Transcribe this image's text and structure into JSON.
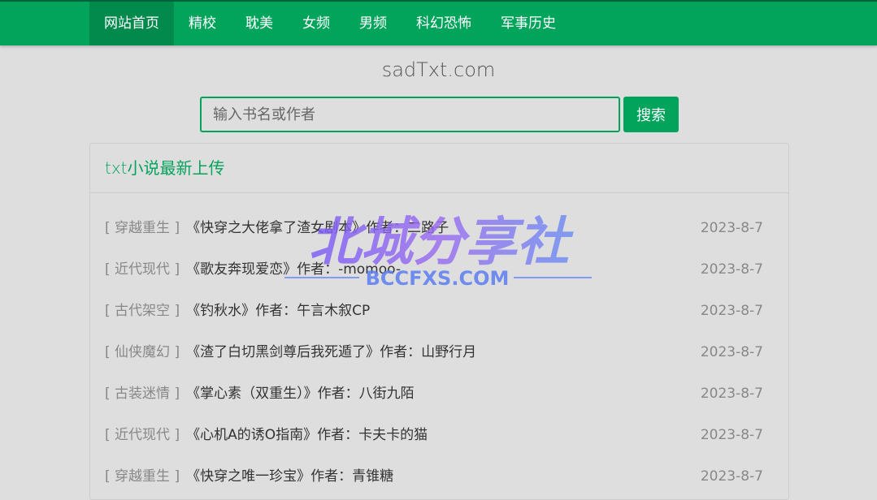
{
  "nav": {
    "items": [
      {
        "label": "网站首页",
        "active": true
      },
      {
        "label": "精校"
      },
      {
        "label": "耽美"
      },
      {
        "label": "女频"
      },
      {
        "label": "男频"
      },
      {
        "label": "科幻恐怖"
      },
      {
        "label": "军事历史"
      }
    ]
  },
  "site_title": "sadTxt.com",
  "search": {
    "placeholder": "输入书名或作者",
    "button_label": "搜索"
  },
  "panel": {
    "title_prefix": "txt",
    "title_rest": "小说最新上传",
    "rows": [
      {
        "category": "[ 穿越重生 ]",
        "book": "《快穿之大佬拿了渣女剧本》",
        "author_label": "作者：",
        "author": "二路子",
        "date": "2023-8-7"
      },
      {
        "category": "[ 近代现代 ]",
        "book": "《歌友奔现爱恋》",
        "author_label": "作者：",
        "author": "-momoo-",
        "date": "2023-8-7"
      },
      {
        "category": "[ 古代架空 ]",
        "book": "《钓秋水》",
        "author_label": "作者：",
        "author": "午言木叙CP",
        "date": "2023-8-7"
      },
      {
        "category": "[ 仙侠魔幻 ]",
        "book": "《渣了白切黑剑尊后我死遁了》",
        "author_label": "作者：",
        "author": "山野行月",
        "date": "2023-8-7"
      },
      {
        "category": "[ 古装迷情 ]",
        "book": "《掌心素（双重生）》",
        "author_label": "作者：",
        "author": "八街九陌",
        "date": "2023-8-7"
      },
      {
        "category": "[ 近代现代 ]",
        "book": "《心机A的诱O指南》",
        "author_label": "作者：",
        "author": "卡夫卡的猫",
        "date": "2023-8-7"
      },
      {
        "category": "[ 穿越重生 ]",
        "book": "《快穿之唯一珍宝》",
        "author_label": "作者：",
        "author": "青锥糖",
        "date": "2023-8-7"
      }
    ]
  },
  "watermark": {
    "main": "北城分享社",
    "sub": "BCCFXS.COM"
  },
  "colors": {
    "brand_green": "#02a35b",
    "nav_active": "#028a4d",
    "page_bg": "#dedede"
  }
}
